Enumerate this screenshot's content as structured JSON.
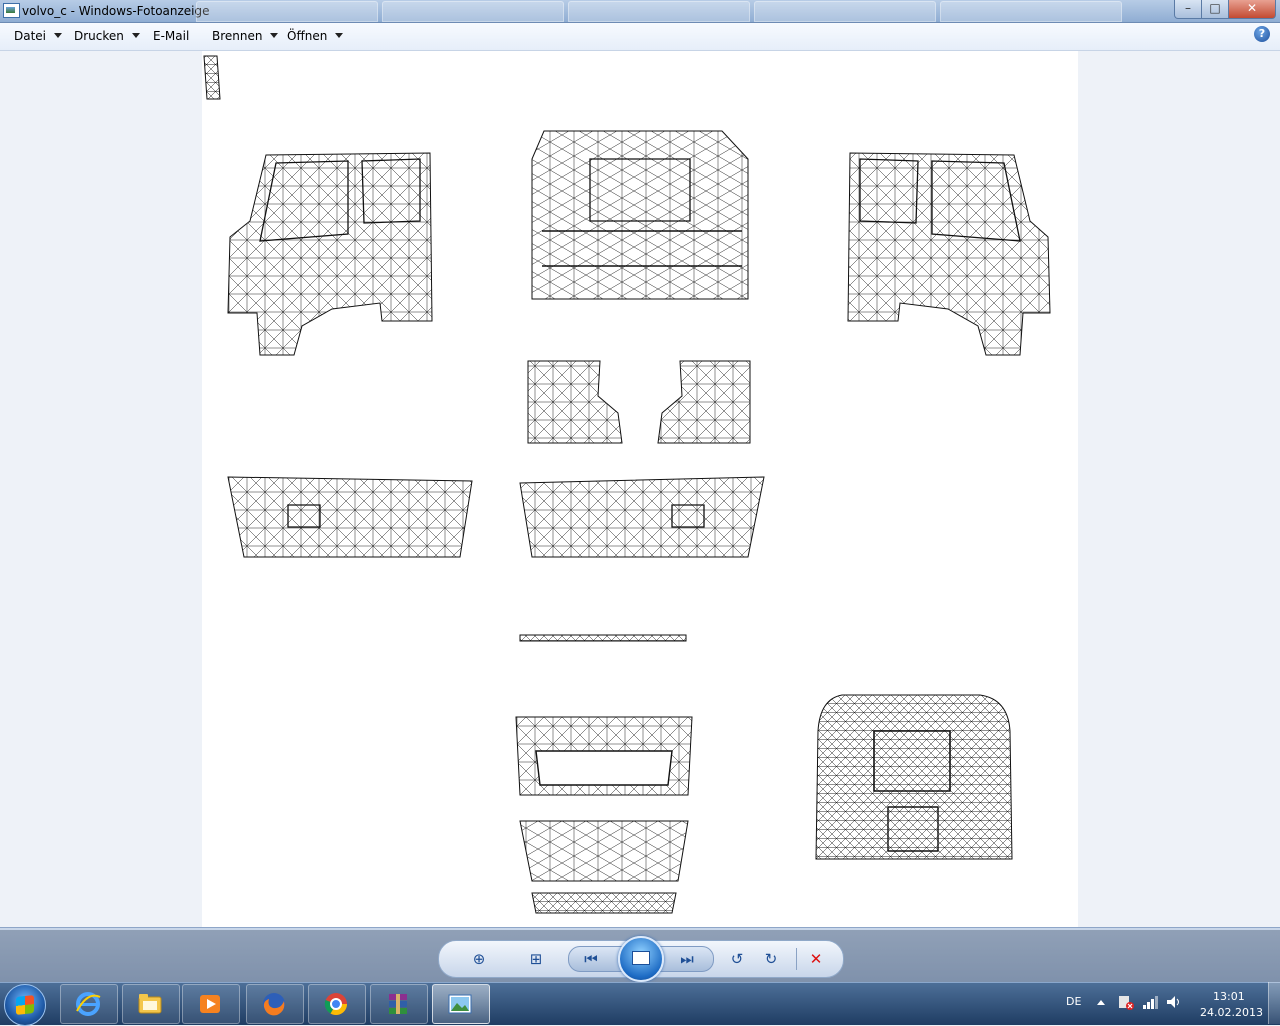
{
  "window": {
    "title": "volvo_c - Windows-Fotoanzeige"
  },
  "menu": {
    "items": [
      {
        "label": "Datei",
        "has_dropdown": true
      },
      {
        "label": "Drucken",
        "has_dropdown": true
      },
      {
        "label": "E-Mail",
        "has_dropdown": false
      },
      {
        "label": "Brennen",
        "has_dropdown": true
      },
      {
        "label": "Öffnen",
        "has_dropdown": true
      }
    ],
    "help_icon": "?"
  },
  "window_buttons": {
    "minimize": "–",
    "maximize": "□",
    "close": "✕"
  },
  "viewer_controls": [
    {
      "name": "zoom-icon",
      "glyph": "⊕"
    },
    {
      "name": "actual-size-icon",
      "glyph": "⊞"
    },
    {
      "name": "previous-icon",
      "glyph": "⏮"
    },
    {
      "name": "slideshow-icon",
      "glyph": ""
    },
    {
      "name": "next-icon",
      "glyph": "⏭"
    },
    {
      "name": "rotate-left-icon",
      "glyph": "↺"
    },
    {
      "name": "rotate-right-icon",
      "glyph": "↻"
    },
    {
      "name": "delete-icon",
      "glyph": "✕"
    }
  ],
  "taskbar": {
    "pinned": [
      "internet-explorer-icon",
      "windows-explorer-icon",
      "media-player-icon",
      "firefox-icon",
      "chrome-icon",
      "winrar-icon",
      "photo-viewer-icon"
    ],
    "active_app": "photo-viewer-icon",
    "language": "DE",
    "time": "13:01",
    "date": "24.02.2013"
  },
  "colors": {
    "accent": "#1f4f96",
    "taskbar": "#1f3d63",
    "delete": "#d11111"
  }
}
